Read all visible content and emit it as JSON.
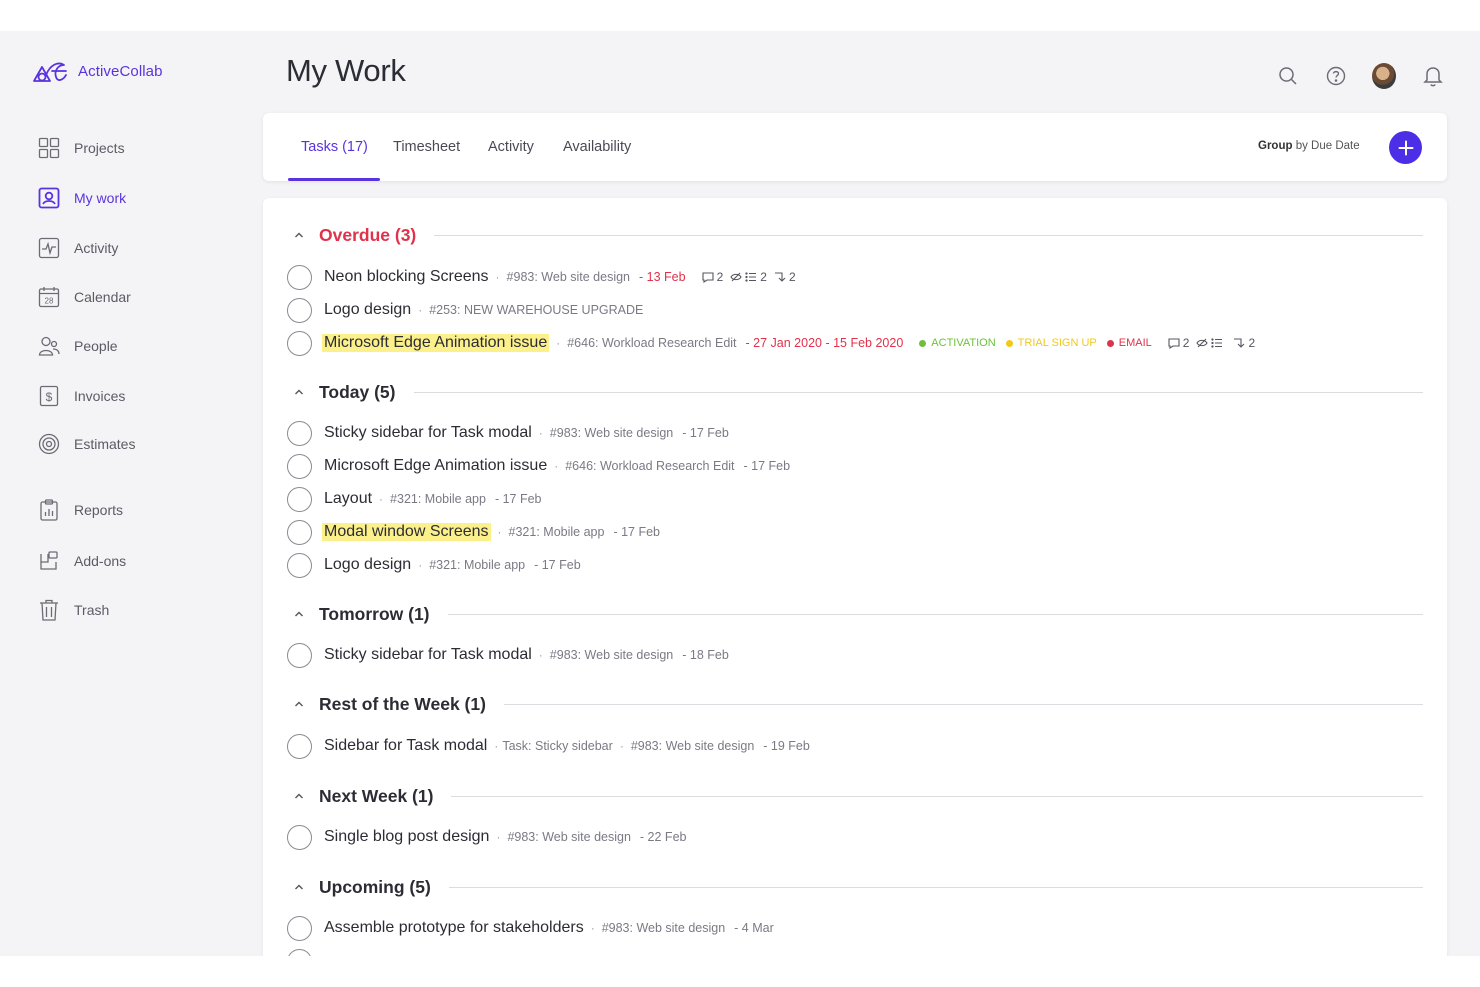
{
  "app": {
    "name": "ActiveCollab",
    "accent": "#5a33e0"
  },
  "sidebar": {
    "items": [
      {
        "label": "Projects",
        "icon": "grid-icon"
      },
      {
        "label": "My work",
        "icon": "user-badge-icon",
        "active": true
      },
      {
        "label": "Activity",
        "icon": "activity-icon"
      },
      {
        "label": "Calendar",
        "icon": "calendar-icon",
        "icon_text": "28"
      },
      {
        "label": "People",
        "icon": "people-icon"
      },
      {
        "label": "Invoices",
        "icon": "invoice-icon"
      },
      {
        "label": "Estimates",
        "icon": "target-icon"
      },
      {
        "label": "Reports",
        "icon": "clipboard-chart-icon"
      },
      {
        "label": "Add-ons",
        "icon": "addons-icon"
      },
      {
        "label": "Trash",
        "icon": "trash-icon"
      }
    ]
  },
  "header": {
    "title": "My Work",
    "icons": [
      "search-icon",
      "help-icon",
      "avatar",
      "bell-icon"
    ]
  },
  "tabs": {
    "items": [
      {
        "label": "Tasks (17)",
        "active": true
      },
      {
        "label": "Timesheet"
      },
      {
        "label": "Activity"
      },
      {
        "label": "Availability"
      }
    ],
    "group_by_bold": "Group",
    "group_by_rest": "by Due Date",
    "add_icon": "plus-icon"
  },
  "groups": [
    {
      "title": "Overdue (3)",
      "overdue": true,
      "tasks": [
        {
          "name": "Neon blocking Screens",
          "project": "#983: Web site design",
          "date": "- 13 Feb",
          "date_red": true,
          "badges": {
            "comments": "2",
            "hidden": true,
            "subtasks": "2",
            "links": "2"
          }
        },
        {
          "name": "Logo design",
          "project": "#253: NEW WAREHOUSE UPGRADE"
        },
        {
          "name": "Microsoft Edge Animation issue",
          "highlight": true,
          "project": "#646: Workload Research Edit",
          "date": "- 27 Jan 2020 - 15 Feb 2020",
          "date_red": true,
          "labels": [
            {
              "text": "ACTIVATION",
              "color": "#6cc03a"
            },
            {
              "text": "TRIAL SIGN UP",
              "color": "#f2c81a"
            },
            {
              "text": "EMAIL",
              "color": "#e0324b"
            }
          ],
          "badges": {
            "comments": "2",
            "hidden": true,
            "subtasks": "",
            "links": "2"
          }
        }
      ]
    },
    {
      "title": "Today (5)",
      "tasks": [
        {
          "name": "Sticky sidebar for Task modal",
          "project": "#983: Web site design",
          "date": "- 17 Feb"
        },
        {
          "name": "Microsoft Edge Animation issue",
          "project": "#646: Workload Research Edit",
          "date": "- 17 Feb"
        },
        {
          "name": "Layout",
          "project": "#321: Mobile app",
          "date": "- 17 Feb"
        },
        {
          "name": "Modal window Screens",
          "highlight": true,
          "project": "#321: Mobile app",
          "date": "- 17 Feb"
        },
        {
          "name": "Logo design",
          "project": "#321: Mobile app",
          "date": "- 17 Feb"
        }
      ]
    },
    {
      "title": "Tomorrow (1)",
      "tasks": [
        {
          "name": "Sticky sidebar for Task modal",
          "project": "#983: Web site design",
          "date": "- 18 Feb"
        }
      ]
    },
    {
      "title": "Rest of the Week (1)",
      "tasks": [
        {
          "name": "Sidebar for Task modal",
          "parent": "Task: Sticky sidebar",
          "project": "#983: Web site design",
          "date": "- 19 Feb"
        }
      ]
    },
    {
      "title": "Next Week (1)",
      "tasks": [
        {
          "name": "Single blog post design",
          "project": "#983: Web site design",
          "date": "- 22 Feb"
        }
      ]
    },
    {
      "title": "Upcoming (5)",
      "tasks": [
        {
          "name": "Assemble prototype for stakeholders",
          "project": "#983: Web site design",
          "date": "- 4 Mar"
        }
      ]
    }
  ]
}
